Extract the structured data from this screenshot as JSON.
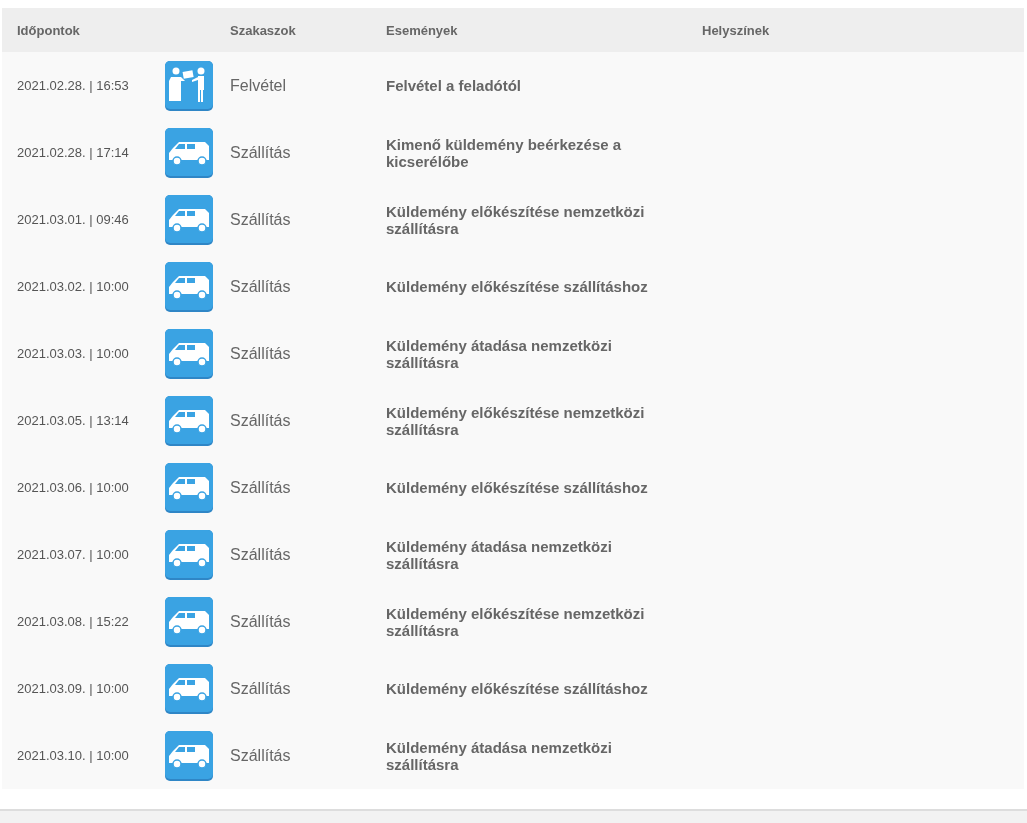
{
  "table": {
    "columns": [
      "Időpontok",
      "Szakaszok",
      "Események",
      "Helyszínek"
    ],
    "rows": [
      {
        "time": "2021.02.28. | 16:53",
        "kind": "counter",
        "stage": "Felvétel",
        "event": "Felvétel a feladótól"
      },
      {
        "time": "2021.02.28. | 17:14",
        "kind": "van",
        "stage": "Szállítás",
        "event": "Kimenő küldemény beérkezése a kicserélőbe"
      },
      {
        "time": "2021.03.01. | 09:46",
        "kind": "van",
        "stage": "Szállítás",
        "event": "Küldemény előkészítése nemzetközi szállításra"
      },
      {
        "time": "2021.03.02. | 10:00",
        "kind": "van",
        "stage": "Szállítás",
        "event": "Küldemény előkészítése szállításhoz"
      },
      {
        "time": "2021.03.03. | 10:00",
        "kind": "van",
        "stage": "Szállítás",
        "event": "Küldemény átadása nemzetközi szállításra"
      },
      {
        "time": "2021.03.05. | 13:14",
        "kind": "van",
        "stage": "Szállítás",
        "event": "Küldemény előkészítése nemzetközi szállításra"
      },
      {
        "time": "2021.03.06. | 10:00",
        "kind": "van",
        "stage": "Szállítás",
        "event": "Küldemény előkészítése szállításhoz"
      },
      {
        "time": "2021.03.07. | 10:00",
        "kind": "van",
        "stage": "Szállítás",
        "event": "Küldemény átadása nemzetközi szállításra"
      },
      {
        "time": "2021.03.08. | 15:22",
        "kind": "van",
        "stage": "Szállítás",
        "event": "Küldemény előkészítése nemzetközi szállításra"
      },
      {
        "time": "2021.03.09. | 10:00",
        "kind": "van",
        "stage": "Szállítás",
        "event": "Küldemény előkészítése szállításhoz"
      },
      {
        "time": "2021.03.10. | 10:00",
        "kind": "van",
        "stage": "Szállítás",
        "event": "Küldemény átadása nemzetközi szállításra"
      }
    ]
  }
}
